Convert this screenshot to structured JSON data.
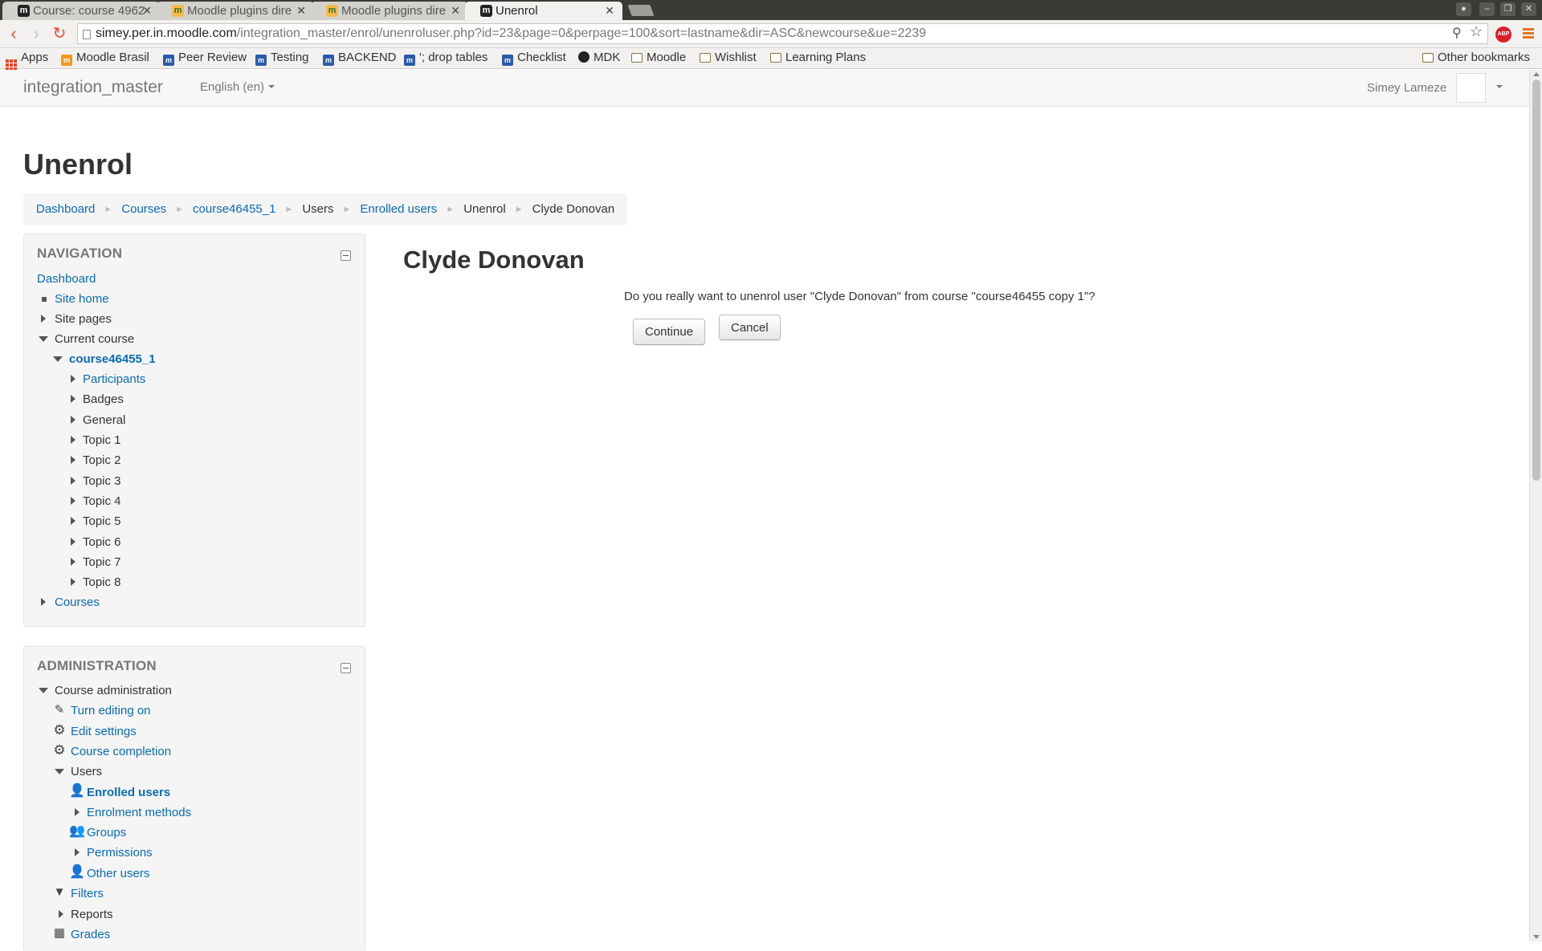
{
  "browser": {
    "tabs": [
      {
        "title": "Course: course 4962",
        "favicon": "moodle-m"
      },
      {
        "title": "Moodle plugins dire",
        "favicon": "moodle-hat"
      },
      {
        "title": "Moodle plugins dire",
        "favicon": "moodle-hat"
      },
      {
        "title": "Unenrol",
        "favicon": "moodle-m",
        "active": true
      }
    ],
    "url_host": "simey.per.in.moodle.com",
    "url_path": "/integration_master/enrol/unenroluser.php?id=23&page=0&perpage=100&sort=lastname&dir=ASC&newcourse&ue=2239",
    "bookmarks": [
      {
        "label": "Apps",
        "icon": "apps-grid-icon"
      },
      {
        "label": "Moodle Brasil",
        "icon": "moodle-icon"
      },
      {
        "label": "Peer Review",
        "icon": "moodle-icon"
      },
      {
        "label": "Testing",
        "icon": "moodle-icon"
      },
      {
        "label": "BACKEND",
        "icon": "moodle-icon"
      },
      {
        "label": "'; drop tables",
        "icon": "moodle-icon"
      },
      {
        "label": "Checklist",
        "icon": "moodle-icon"
      },
      {
        "label": "MDK",
        "icon": "github-icon"
      },
      {
        "label": "Moodle",
        "icon": "folder-icon"
      },
      {
        "label": "Wishlist",
        "icon": "folder-icon"
      },
      {
        "label": "Learning Plans",
        "icon": "folder-icon"
      },
      {
        "label": "Other bookmarks",
        "icon": "folder-icon"
      }
    ],
    "abp_label": "ABP"
  },
  "navbar": {
    "brand": "integration_master",
    "language": "English (en)",
    "user_name": "Simey Lameze"
  },
  "page": {
    "title": "Unenrol",
    "breadcrumb": [
      {
        "label": "Dashboard",
        "link": true
      },
      {
        "label": "Courses",
        "link": true
      },
      {
        "label": "course46455_1",
        "link": true
      },
      {
        "label": "Users",
        "link": false
      },
      {
        "label": "Enrolled users",
        "link": true
      },
      {
        "label": "Unenrol",
        "link": false
      },
      {
        "label": "Clyde Donovan",
        "link": false
      }
    ]
  },
  "navigation": {
    "title": "NAVIGATION",
    "dashboard": "Dashboard",
    "site_home": "Site home",
    "site_pages": "Site pages",
    "current_course": "Current course",
    "course": "course46455_1",
    "course_items": [
      {
        "label": "Participants",
        "link": true
      },
      {
        "label": "Badges",
        "link": false
      },
      {
        "label": "General",
        "link": false
      },
      {
        "label": "Topic 1",
        "link": false
      },
      {
        "label": "Topic 2",
        "link": false
      },
      {
        "label": "Topic 3",
        "link": false
      },
      {
        "label": "Topic 4",
        "link": false
      },
      {
        "label": "Topic 5",
        "link": false
      },
      {
        "label": "Topic 6",
        "link": false
      },
      {
        "label": "Topic 7",
        "link": false
      },
      {
        "label": "Topic 8",
        "link": false
      }
    ],
    "courses": "Courses"
  },
  "administration": {
    "title": "ADMINISTRATION",
    "course_admin": "Course administration",
    "turn_editing_on": "Turn editing on",
    "edit_settings": "Edit settings",
    "course_completion": "Course completion",
    "users": "Users",
    "enrolled_users": "Enrolled users",
    "enrolment_methods": "Enrolment methods",
    "groups": "Groups",
    "permissions": "Permissions",
    "other_users": "Other users",
    "filters": "Filters",
    "reports": "Reports",
    "grades": "Grades"
  },
  "main": {
    "heading": "Clyde Donovan",
    "message": "Do you really want to unenrol user \"Clyde Donovan\" from course \"course46455 copy 1\"?",
    "continue_label": "Continue",
    "cancel_label": "Cancel"
  },
  "colors": {
    "link": "#0a6bb0",
    "tab_bar": "#3b3a36",
    "block_bg": "#f5f5f5"
  }
}
